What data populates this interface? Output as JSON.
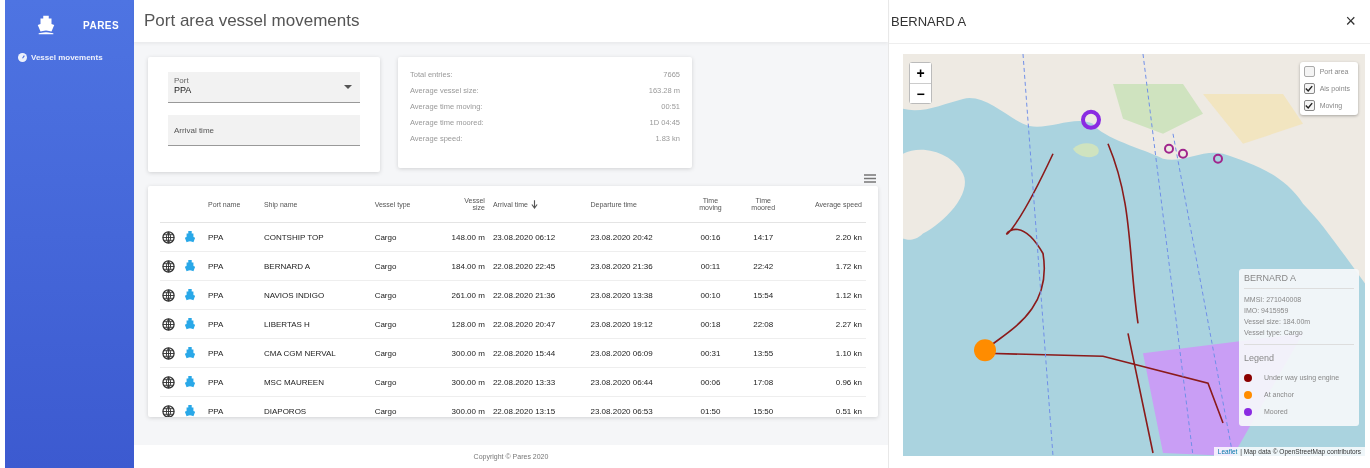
{
  "sidebar": {
    "brand": "PARES",
    "items": [
      {
        "label": "Vessel movements"
      }
    ]
  },
  "page_title": "Port area vessel movements",
  "filters": {
    "port": {
      "label": "Port",
      "value": "PPA"
    },
    "arrival_time": {
      "placeholder": "Arrival time"
    }
  },
  "stats": [
    {
      "label": "Total entries:",
      "value": "7665"
    },
    {
      "label": "Average vessel size:",
      "value": "163.28 m"
    },
    {
      "label": "Average time moving:",
      "value": "00:51"
    },
    {
      "label": "Average time moored:",
      "value": "1D 04:45"
    },
    {
      "label": "Average speed:",
      "value": "1.83 kn"
    }
  ],
  "table": {
    "columns": [
      {
        "label": "Port name",
        "sorted": false
      },
      {
        "label": "Ship name",
        "sorted": false
      },
      {
        "label": "Vessel type",
        "sorted": false
      },
      {
        "label": "Vessel size",
        "sorted": false
      },
      {
        "label": "Arrival time",
        "sorted": true
      },
      {
        "label": "Departure time",
        "sorted": false
      },
      {
        "label": "Time moving",
        "sorted": false
      },
      {
        "label": "Time moored",
        "sorted": false
      },
      {
        "label": "Average speed",
        "sorted": false
      }
    ],
    "rows": [
      [
        "PPA",
        "CONTSHIP TOP",
        "Cargo",
        "148.00 m",
        "23.08.2020 06:12",
        "23.08.2020 20:42",
        "00:16",
        "14:17",
        "2.20 kn"
      ],
      [
        "PPA",
        "BERNARD A",
        "Cargo",
        "184.00 m",
        "22.08.2020 22:45",
        "23.08.2020 21:36",
        "00:11",
        "22:42",
        "1.72 kn"
      ],
      [
        "PPA",
        "NAVIOS INDIGO",
        "Cargo",
        "261.00 m",
        "22.08.2020 21:36",
        "23.08.2020 13:38",
        "00:10",
        "15:54",
        "1.12 kn"
      ],
      [
        "PPA",
        "LIBERTAS H",
        "Cargo",
        "128.00 m",
        "22.08.2020 20:47",
        "23.08.2020 19:12",
        "00:18",
        "22:08",
        "2.27 kn"
      ],
      [
        "PPA",
        "CMA CGM NERVAL",
        "Cargo",
        "300.00 m",
        "22.08.2020 15:44",
        "23.08.2020 06:09",
        "00:31",
        "13:55",
        "1.10 kn"
      ],
      [
        "PPA",
        "MSC MAUREEN",
        "Cargo",
        "300.00 m",
        "22.08.2020 13:33",
        "23.08.2020 06:44",
        "00:06",
        "17:08",
        "0.96 kn"
      ],
      [
        "PPA",
        "DIAPOROS",
        "Cargo",
        "300.00 m",
        "22.08.2020 13:15",
        "23.08.2020 06:53",
        "01:50",
        "15:50",
        "0.51 kn"
      ]
    ]
  },
  "footer": "Copyright © Pares 2020",
  "detail": {
    "title": "BERNARD A",
    "close": "×",
    "map": {
      "zoom_in": "+",
      "zoom_out": "−",
      "layers": [
        {
          "label": "Port area",
          "checked": false
        },
        {
          "label": "Ais points",
          "checked": true
        },
        {
          "label": "Moving",
          "checked": true
        }
      ],
      "info": {
        "title": "BERNARD A",
        "lines": [
          "MMSI: 271040008",
          "IMO: 9415959",
          "Vessel size: 184.00m",
          "Vessel type: Cargo"
        ]
      },
      "legend": {
        "title": "Legend",
        "items": [
          {
            "label": "Under way using engine",
            "color": "#8b0000"
          },
          {
            "label": "At anchor",
            "color": "#ff8c00"
          },
          {
            "label": "Moored",
            "color": "#8a2be2"
          }
        ]
      },
      "attribution": {
        "link": "Leaflet",
        "text": "| Map data © OpenStreetMap contributors"
      }
    }
  }
}
